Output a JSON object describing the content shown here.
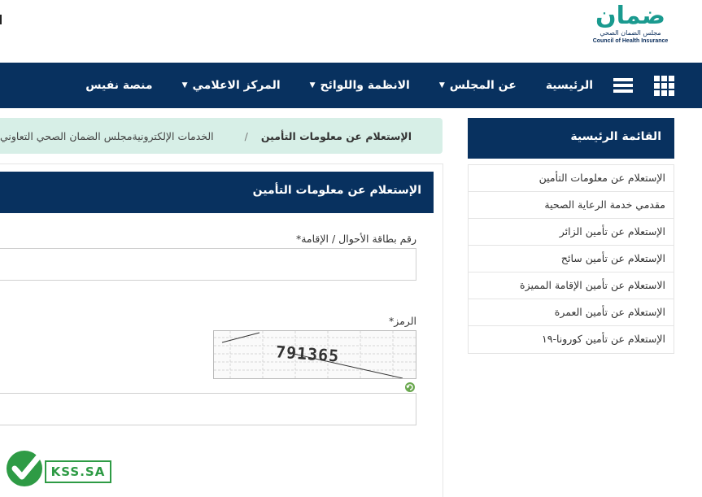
{
  "header": {
    "logo_word": "ضمان",
    "logo_arabic": "مجلس الضمان الصحي",
    "logo_english": "Council of Health Insurance"
  },
  "nav": {
    "items": [
      {
        "label": "الرئيسية",
        "has_dropdown": false
      },
      {
        "label": "عن المجلس",
        "has_dropdown": true
      },
      {
        "label": "الانظمة واللوائح",
        "has_dropdown": true
      },
      {
        "label": "المركز الاعلامي",
        "has_dropdown": true
      },
      {
        "label": "منصة نفيس",
        "has_dropdown": false
      }
    ],
    "icons": [
      "apps-grid-icon",
      "menu-bars-icon"
    ]
  },
  "sidebar": {
    "title": "القائمة الرئيسية",
    "items": [
      {
        "label": "الإستعلام عن معلومات التأمين"
      },
      {
        "label": "مقدمي خدمة الرعاية الصحية"
      },
      {
        "label": "الإستعلام عن تأمين الزائر"
      },
      {
        "label": "الإستعلام عن تأمين سائح"
      },
      {
        "label": "الاستعلام عن تأمين الإقامة المميزة"
      },
      {
        "label": "الإستعلام عن تأمين العمرة"
      },
      {
        "label": "الإستعلام عن تأمين كورونا-١٩"
      }
    ]
  },
  "breadcrumb": {
    "items": [
      "مجلس الضمان الصحي التعاوني",
      "الخدمات الإلكترونية"
    ],
    "separator": "/",
    "current": "الإستعلام عن معلومات التأمين"
  },
  "form": {
    "title": "الإستعلام عن معلومات التأمين",
    "id_label": "رقم بطاقة الأحوال / الإقامة*",
    "id_value": "",
    "captcha_label": "الرمز*",
    "captcha_code": "791365",
    "captcha_value": ""
  },
  "watermark": {
    "text": "KSS.SA"
  },
  "colors": {
    "primary": "#08315f",
    "brand_teal": "#1a9a8f",
    "breadcrumb_bg": "#d7efe7",
    "watermark_green": "#2e9b45"
  }
}
